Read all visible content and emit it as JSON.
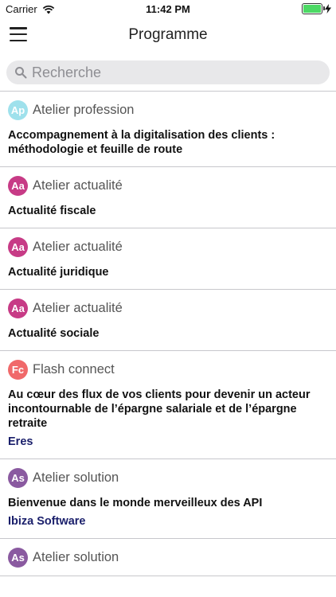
{
  "status_bar": {
    "carrier": "Carrier",
    "time": "11:42 PM",
    "battery_level": 1.0
  },
  "nav": {
    "title": "Programme"
  },
  "search": {
    "placeholder": "Recherche"
  },
  "colors": {
    "ap": "#9fe1ec",
    "aa": "#c73b86",
    "fc": "#f0696a",
    "as": "#8a5aa0",
    "sponsor": "#1a1f6b"
  },
  "items": [
    {
      "badge": "Ap",
      "category": "Atelier profession",
      "title": "Accompagnement à la digitalisation des clients : méthodologie et feuille de route",
      "sponsor": ""
    },
    {
      "badge": "Aa",
      "category": "Atelier actualité",
      "title": "Actualité fiscale",
      "sponsor": ""
    },
    {
      "badge": "Aa",
      "category": "Atelier actualité",
      "title": "Actualité juridique",
      "sponsor": ""
    },
    {
      "badge": "Aa",
      "category": "Atelier actualité",
      "title": "Actualité sociale",
      "sponsor": ""
    },
    {
      "badge": "Fc",
      "category": "Flash connect",
      "title": "Au cœur des flux de vos clients pour devenir un acteur incontournable de l’épargne salariale et de l’épargne retraite",
      "sponsor": "Eres"
    },
    {
      "badge": "As",
      "category": "Atelier solution",
      "title": "Bienvenue dans le monde merveilleux des API",
      "sponsor": "Ibiza Software"
    },
    {
      "badge": "As",
      "category": "Atelier solution",
      "title": "",
      "sponsor": ""
    }
  ]
}
